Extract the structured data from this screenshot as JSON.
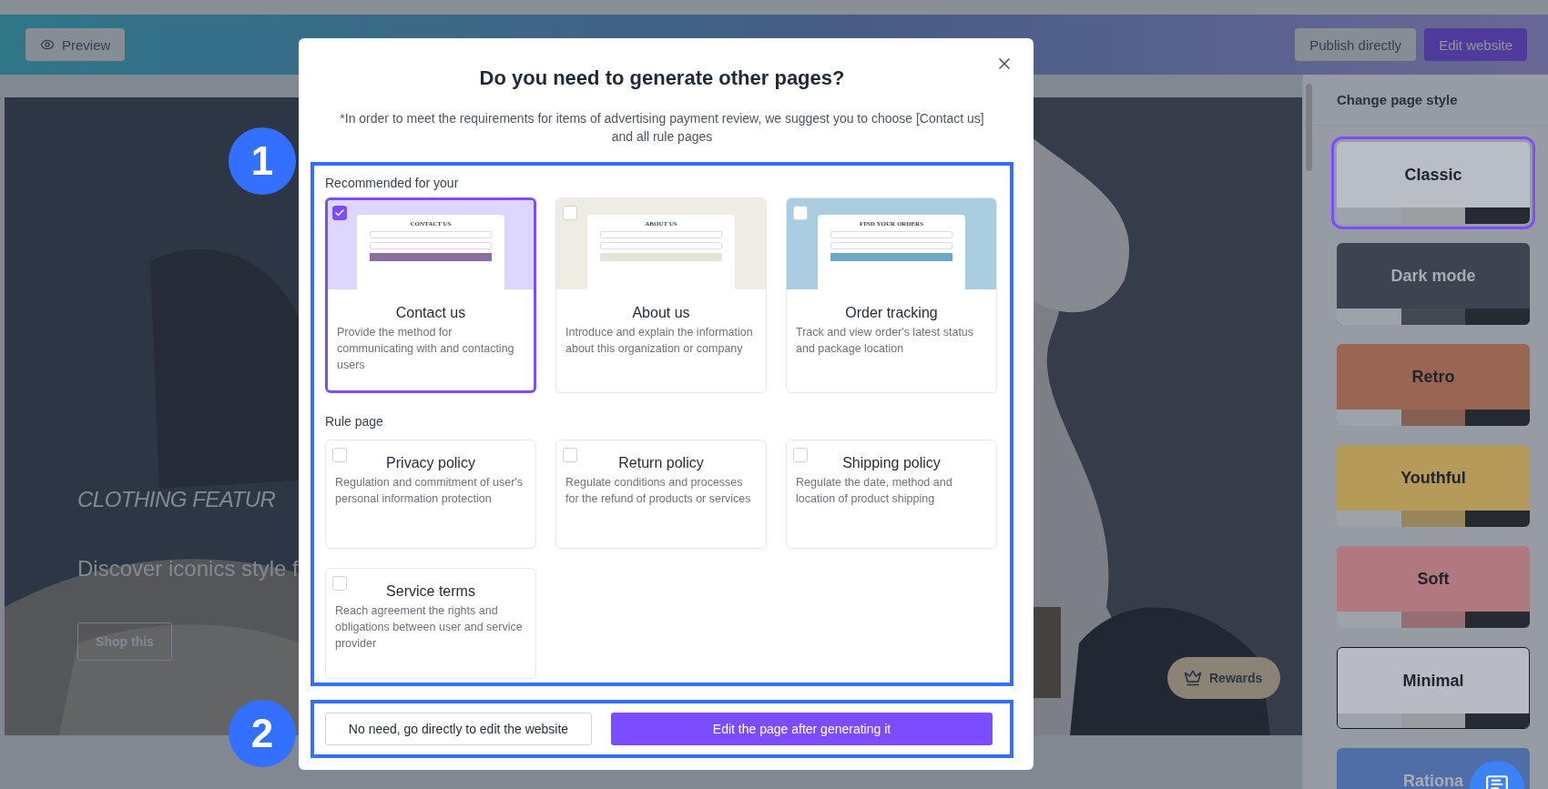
{
  "header": {
    "preview_button": "Preview",
    "publish_button": "Publish directly",
    "edit_button": "Edit website"
  },
  "hero": {
    "headline": "CLOTHING FEATUR",
    "subtitle": "Discover iconics style f",
    "cta": "Shop this",
    "rewards": "Rewards"
  },
  "sidebar": {
    "title": "Change page style",
    "styles": [
      {
        "name": "Classic",
        "selected": true,
        "color": "#b9bdc4"
      },
      {
        "name": "Dark mode",
        "selected": false,
        "color": "#3d4350"
      },
      {
        "name": "Retro",
        "selected": false,
        "color": "#9a6552"
      },
      {
        "name": "Youthful",
        "selected": false,
        "color": "#b59a5a"
      },
      {
        "name": "Soft",
        "selected": false,
        "color": "#b27880"
      },
      {
        "name": "Minimal",
        "selected": false,
        "color": "#b8bbc1"
      },
      {
        "name": "Rationa",
        "selected": false,
        "color": "#4f6ea8"
      }
    ]
  },
  "dialog": {
    "title": "Do you need to generate other pages?",
    "note": "*In order to meet the requirements for items of advertising payment review, we suggest you to choose [Contact us] and all rule pages",
    "markers": [
      "1",
      "2"
    ],
    "recommended": {
      "label": "Recommended for your",
      "pages": [
        {
          "title": "Contact us",
          "description": "Provide the method for communicating with and contacting users",
          "checked": true,
          "preview_title": "CONTACT US",
          "color": "#ddd6fe"
        },
        {
          "title": "About us",
          "description": "Introduce and explain the information about this organization or company",
          "checked": false,
          "preview_title": "ABOUT US",
          "color": "#efede3"
        },
        {
          "title": "Order tracking",
          "description": "Track and view order's latest status and package location",
          "checked": false,
          "preview_title": "FIND YOUR ORDERS",
          "color": "#aacde2"
        }
      ]
    },
    "rules": {
      "label": "Rule page",
      "pages": [
        {
          "title": "Privacy policy",
          "description": "Regulation and commitment of user's personal information protection",
          "checked": false
        },
        {
          "title": "Return policy",
          "description": "Regulate conditions and processes for the refund of products or services",
          "checked": false
        },
        {
          "title": "Shipping policy",
          "description": "Regulate the date, method and location of product shipping",
          "checked": false
        },
        {
          "title": "Service terms",
          "description": "Reach agreement the rights and obligations between user and service provider",
          "checked": false
        }
      ]
    },
    "skip_button": "No need, go directly to edit the website",
    "generate_button": "Edit the page after generating it"
  }
}
